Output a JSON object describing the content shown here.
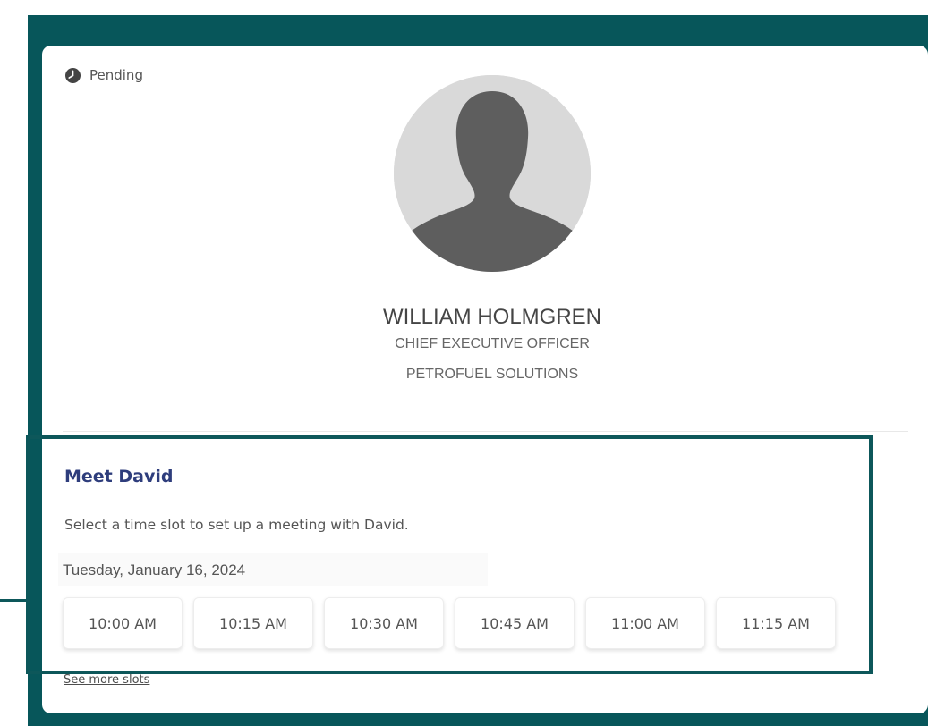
{
  "status": {
    "label": "Pending",
    "icon": "clock-icon"
  },
  "profile": {
    "avatar_icon": "person-silhouette-icon",
    "name": "WILLIAM HOLMGREN",
    "title": "CHIEF EXECUTIVE OFFICER",
    "company": "PETROFUEL SOLUTIONS"
  },
  "meeting": {
    "heading": "Meet David",
    "description": "Select a time slot to set up a meeting with David.",
    "date": "Tuesday, January 16, 2024",
    "slots": [
      "10:00 AM",
      "10:15 AM",
      "10:30 AM",
      "10:45 AM",
      "11:00 AM",
      "11:15 AM"
    ],
    "see_more_label": "See more slots"
  },
  "colors": {
    "frame": "#07565a",
    "highlight_border": "#0d575a",
    "heading": "#2e3d7c"
  }
}
